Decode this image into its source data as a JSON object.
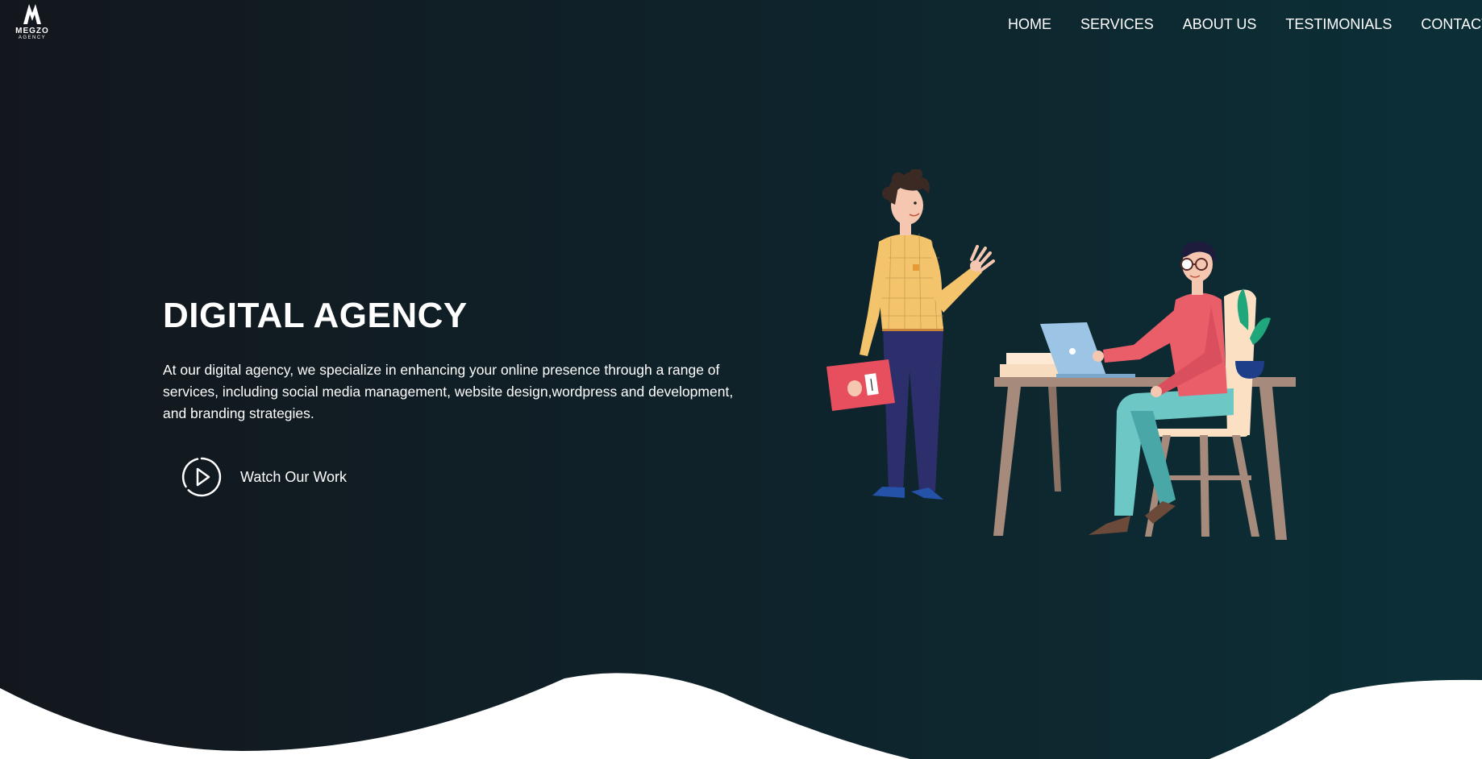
{
  "brand": {
    "name": "MEGZO",
    "tagline": "AGENCY"
  },
  "nav": {
    "items": [
      {
        "label": "HOME"
      },
      {
        "label": "SERVICES"
      },
      {
        "label": "ABOUT US"
      },
      {
        "label": "TESTIMONIALS"
      },
      {
        "label": "CONTACT"
      }
    ]
  },
  "hero": {
    "title": "DIGITAL AGENCY",
    "description": "At our digital agency, we specialize in enhancing your online presence through a range of services, including social media management, website design,wordpress and development, and branding strategies.",
    "cta_label": "Watch Our Work",
    "cta_icon": "play-circle-icon"
  },
  "colors": {
    "background_start": "#13171d",
    "background_end": "#0c2f37",
    "text": "#ffffff",
    "wave": "#ffffff"
  }
}
